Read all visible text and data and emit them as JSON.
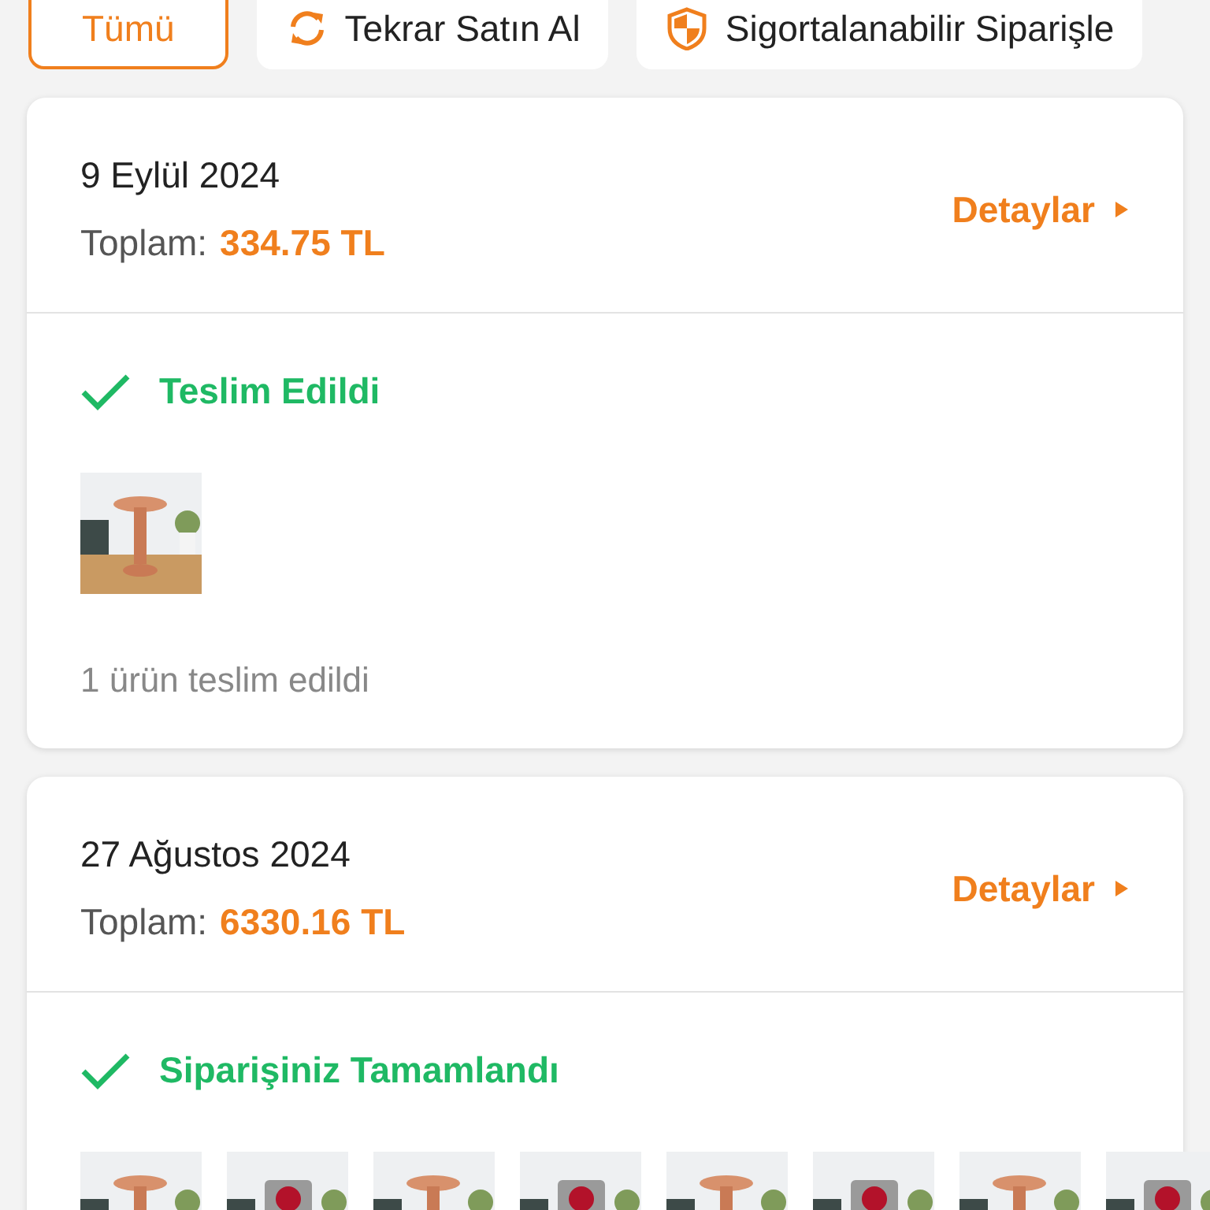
{
  "tabs": [
    {
      "label": "Tümü",
      "kind": "plain",
      "selected": true
    },
    {
      "label": "Tekrar Satın Al",
      "kind": "repeat",
      "selected": false
    },
    {
      "label": "Sigortalanabilir Siparişle",
      "kind": "shield",
      "selected": false
    }
  ],
  "orders": [
    {
      "date": "9 Eylül 2024",
      "total_label": "Toplam:",
      "total": "334.75 TL",
      "details": "Detaylar",
      "status": "Teslim Edildi",
      "note": "1 ürün teslim edildi"
    },
    {
      "date": "27 Ağustos 2024",
      "total_label": "Toplam:",
      "total": "6330.16 TL",
      "details": "Detaylar",
      "status": "Siparişiniz Tamamlandı"
    }
  ]
}
